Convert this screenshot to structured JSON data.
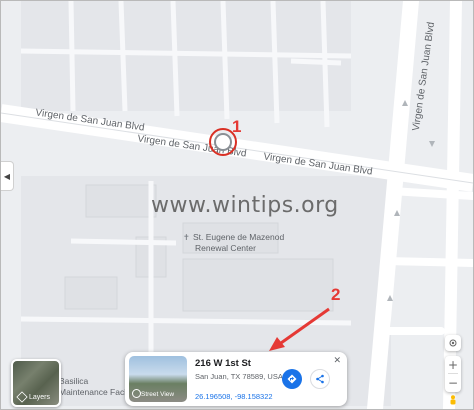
{
  "map": {
    "streets": {
      "blvd_left": "Virgen de San Juan Blvd",
      "blvd_mid": "Virgen de San Juan Blvd",
      "blvd_right": "Virgen de San Juan Blvd",
      "vertical": "Virgen de San Juan Blvd"
    },
    "places": {
      "church_line1": "St. Eugene de Mazenod",
      "church_line2": "Renewal Center",
      "basilica_line1": "Basilica",
      "basilica_line2": "Maintenance Facili"
    },
    "watermark": "www.wintips.org",
    "annotations": {
      "marker1": "1",
      "marker2": "2"
    }
  },
  "layers_button": {
    "label": "Layers",
    "icon": "layers-icon"
  },
  "place_card": {
    "address": "216 W 1st St",
    "city": "San Juan, TX 78589, USA",
    "coordinates": "26.196508, -98.158322",
    "thumbnail_label": "Street View",
    "close_label": "✕",
    "directions_icon": "directions-icon",
    "share_icon": "share-icon"
  },
  "colors": {
    "accent": "#1a73e8",
    "annotation": "#e53935",
    "map_background": "#eceef1",
    "road": "#ffffff"
  }
}
